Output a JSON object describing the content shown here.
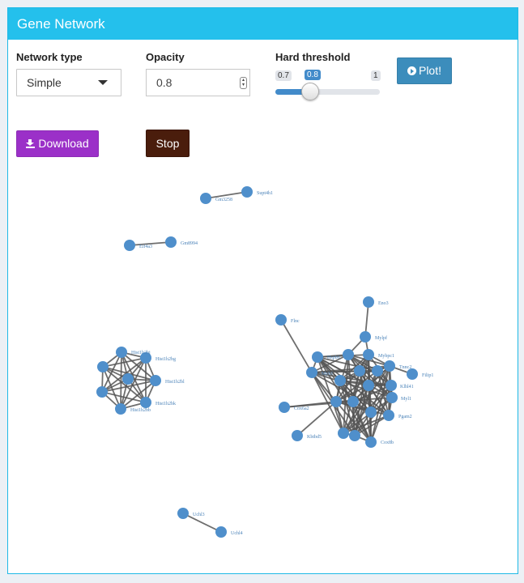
{
  "panel": {
    "title": "Gene Network"
  },
  "controls": {
    "network_type": {
      "label": "Network type",
      "value": "Simple"
    },
    "opacity": {
      "label": "Opacity",
      "value": "0.8"
    },
    "threshold": {
      "label": "Hard threshold",
      "min": "0.7",
      "value": "0.8",
      "max": "1",
      "fraction": 0.33
    },
    "plot_label": "Plot!",
    "download_label": "Download",
    "stop_label": "Stop"
  },
  "colors": {
    "header": "#24c0ec",
    "node": "#4f8fcb",
    "edge": "#555555",
    "label": "#4a82b8",
    "download": "#9b30c8",
    "stop": "#4a1d0c",
    "plot": "#3c8dbc"
  },
  "icons": {
    "plot": "play-circle-icon",
    "download": "download-icon",
    "select": "caret-down-icon",
    "spinner": "spinner-arrows-icon"
  },
  "network": {
    "labels": [
      "Gm3258",
      "Supt4h1",
      "Eif4a3",
      "Gm8994",
      "Hist1h2bj",
      "Hist1h2bg",
      "Hist1h2bl",
      "Hist1h2bk",
      "Hist1h2bb",
      "Flnc",
      "Eno3",
      "Mylpf",
      "Hspb6",
      "Atp2a1",
      "Myh1",
      "Ckm",
      "Tnnt3",
      "Tnnc2",
      "Pvalb",
      "Actn3",
      "Filip1",
      "Klhl41",
      "Klhl40",
      "Kbtbd5",
      "Cox6a2",
      "Myl1",
      "Kbtbd5",
      "Trim72",
      "Ppp1r3a",
      "Tcap",
      "Ttn",
      "Ak1",
      "Casq1",
      "Klhdc8b",
      "Mybpc1",
      "Fhl3",
      "Cox8b",
      "Smpx",
      "Ankrd2",
      "Ptgsi",
      "Ckmt2",
      "Mybpc2",
      "Kbtbd5",
      "Pgam2",
      "Tpm1",
      "Ldb3",
      "Uchl3",
      "Uchl4",
      "Ttnb",
      "Tpm2",
      "Mylk2",
      "Myot",
      "Sln"
    ]
  }
}
